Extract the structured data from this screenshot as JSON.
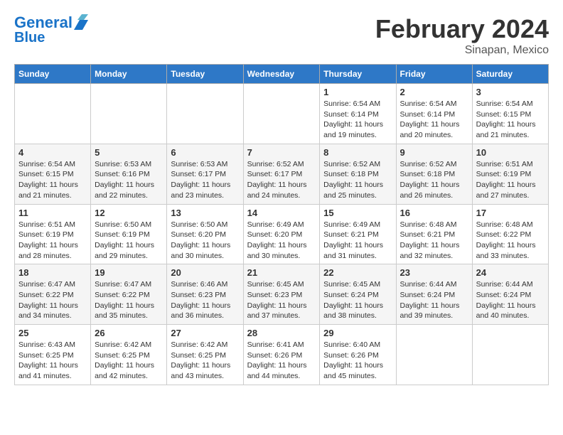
{
  "header": {
    "logo_line1": "General",
    "logo_line2": "Blue",
    "title": "February 2024",
    "subtitle": "Sinapan, Mexico"
  },
  "weekdays": [
    "Sunday",
    "Monday",
    "Tuesday",
    "Wednesday",
    "Thursday",
    "Friday",
    "Saturday"
  ],
  "weeks": [
    [
      {
        "day": "",
        "info": ""
      },
      {
        "day": "",
        "info": ""
      },
      {
        "day": "",
        "info": ""
      },
      {
        "day": "",
        "info": ""
      },
      {
        "day": "1",
        "info": "Sunrise: 6:54 AM\nSunset: 6:14 PM\nDaylight: 11 hours\nand 19 minutes."
      },
      {
        "day": "2",
        "info": "Sunrise: 6:54 AM\nSunset: 6:14 PM\nDaylight: 11 hours\nand 20 minutes."
      },
      {
        "day": "3",
        "info": "Sunrise: 6:54 AM\nSunset: 6:15 PM\nDaylight: 11 hours\nand 21 minutes."
      }
    ],
    [
      {
        "day": "4",
        "info": "Sunrise: 6:54 AM\nSunset: 6:15 PM\nDaylight: 11 hours\nand 21 minutes."
      },
      {
        "day": "5",
        "info": "Sunrise: 6:53 AM\nSunset: 6:16 PM\nDaylight: 11 hours\nand 22 minutes."
      },
      {
        "day": "6",
        "info": "Sunrise: 6:53 AM\nSunset: 6:17 PM\nDaylight: 11 hours\nand 23 minutes."
      },
      {
        "day": "7",
        "info": "Sunrise: 6:52 AM\nSunset: 6:17 PM\nDaylight: 11 hours\nand 24 minutes."
      },
      {
        "day": "8",
        "info": "Sunrise: 6:52 AM\nSunset: 6:18 PM\nDaylight: 11 hours\nand 25 minutes."
      },
      {
        "day": "9",
        "info": "Sunrise: 6:52 AM\nSunset: 6:18 PM\nDaylight: 11 hours\nand 26 minutes."
      },
      {
        "day": "10",
        "info": "Sunrise: 6:51 AM\nSunset: 6:19 PM\nDaylight: 11 hours\nand 27 minutes."
      }
    ],
    [
      {
        "day": "11",
        "info": "Sunrise: 6:51 AM\nSunset: 6:19 PM\nDaylight: 11 hours\nand 28 minutes."
      },
      {
        "day": "12",
        "info": "Sunrise: 6:50 AM\nSunset: 6:19 PM\nDaylight: 11 hours\nand 29 minutes."
      },
      {
        "day": "13",
        "info": "Sunrise: 6:50 AM\nSunset: 6:20 PM\nDaylight: 11 hours\nand 30 minutes."
      },
      {
        "day": "14",
        "info": "Sunrise: 6:49 AM\nSunset: 6:20 PM\nDaylight: 11 hours\nand 30 minutes."
      },
      {
        "day": "15",
        "info": "Sunrise: 6:49 AM\nSunset: 6:21 PM\nDaylight: 11 hours\nand 31 minutes."
      },
      {
        "day": "16",
        "info": "Sunrise: 6:48 AM\nSunset: 6:21 PM\nDaylight: 11 hours\nand 32 minutes."
      },
      {
        "day": "17",
        "info": "Sunrise: 6:48 AM\nSunset: 6:22 PM\nDaylight: 11 hours\nand 33 minutes."
      }
    ],
    [
      {
        "day": "18",
        "info": "Sunrise: 6:47 AM\nSunset: 6:22 PM\nDaylight: 11 hours\nand 34 minutes."
      },
      {
        "day": "19",
        "info": "Sunrise: 6:47 AM\nSunset: 6:22 PM\nDaylight: 11 hours\nand 35 minutes."
      },
      {
        "day": "20",
        "info": "Sunrise: 6:46 AM\nSunset: 6:23 PM\nDaylight: 11 hours\nand 36 minutes."
      },
      {
        "day": "21",
        "info": "Sunrise: 6:45 AM\nSunset: 6:23 PM\nDaylight: 11 hours\nand 37 minutes."
      },
      {
        "day": "22",
        "info": "Sunrise: 6:45 AM\nSunset: 6:24 PM\nDaylight: 11 hours\nand 38 minutes."
      },
      {
        "day": "23",
        "info": "Sunrise: 6:44 AM\nSunset: 6:24 PM\nDaylight: 11 hours\nand 39 minutes."
      },
      {
        "day": "24",
        "info": "Sunrise: 6:44 AM\nSunset: 6:24 PM\nDaylight: 11 hours\nand 40 minutes."
      }
    ],
    [
      {
        "day": "25",
        "info": "Sunrise: 6:43 AM\nSunset: 6:25 PM\nDaylight: 11 hours\nand 41 minutes."
      },
      {
        "day": "26",
        "info": "Sunrise: 6:42 AM\nSunset: 6:25 PM\nDaylight: 11 hours\nand 42 minutes."
      },
      {
        "day": "27",
        "info": "Sunrise: 6:42 AM\nSunset: 6:25 PM\nDaylight: 11 hours\nand 43 minutes."
      },
      {
        "day": "28",
        "info": "Sunrise: 6:41 AM\nSunset: 6:26 PM\nDaylight: 11 hours\nand 44 minutes."
      },
      {
        "day": "29",
        "info": "Sunrise: 6:40 AM\nSunset: 6:26 PM\nDaylight: 11 hours\nand 45 minutes."
      },
      {
        "day": "",
        "info": ""
      },
      {
        "day": "",
        "info": ""
      }
    ]
  ]
}
